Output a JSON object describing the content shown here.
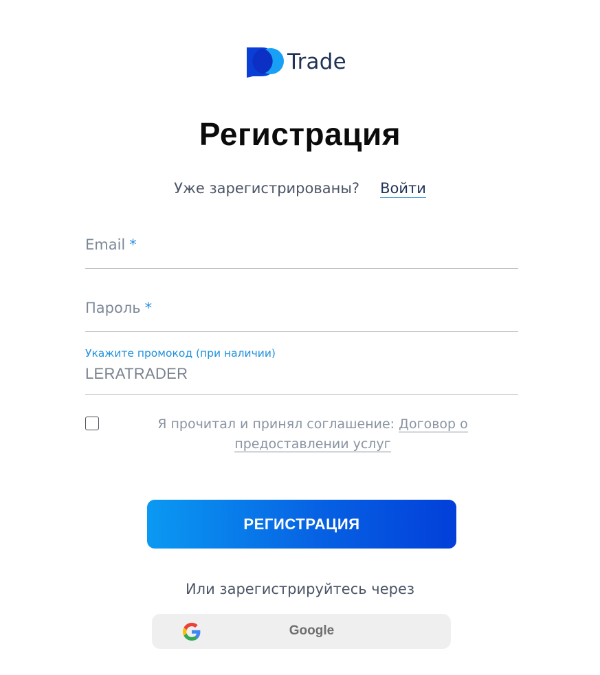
{
  "brand": {
    "name": "Trade",
    "colors": {
      "logo_blue": "#0a3fd6",
      "logo_light": "#17a0f5",
      "text": "#1f3356"
    }
  },
  "page": {
    "title": "Регистрация"
  },
  "login_prompt": {
    "question": "Уже зарегистрированы?",
    "link_label": "Войти"
  },
  "form": {
    "email": {
      "placeholder": "Email",
      "required_mark": "*"
    },
    "password": {
      "placeholder": "Пароль",
      "required_mark": "*"
    },
    "promo": {
      "label": "Укажите промокод (при наличии)",
      "value": "LERATRADER"
    },
    "agreement": {
      "text": "Я прочитал и принял соглашение:",
      "link_part1": "Договор о",
      "link_part2": "предоставлении услуг",
      "checked": false
    },
    "submit_label": "РЕГИСТРАЦИЯ",
    "submit_gradient": [
      "#0a99f2",
      "#023fd9"
    ]
  },
  "social": {
    "prompt": "Или зарегистрируйтесь через",
    "google_label": "Google",
    "google_icon": "google-icon"
  }
}
